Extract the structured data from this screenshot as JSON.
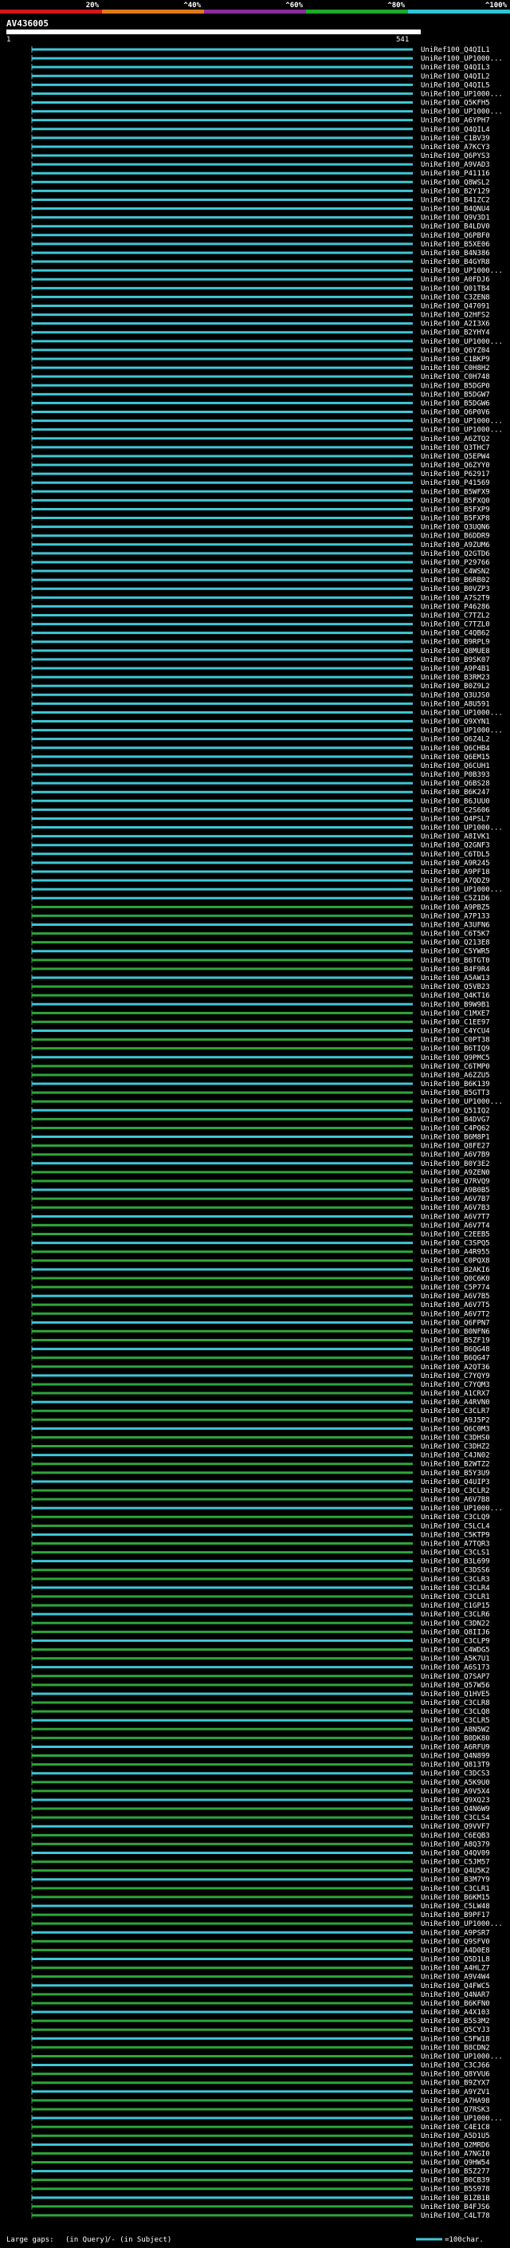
{
  "query_id": "AV436005",
  "colors": {
    "background": "#000000",
    "aligned_low": "#2ea63a",
    "aligned_high": "#3fc7d6",
    "gap": "#000000",
    "text": "#ffffff"
  },
  "legend_top": {
    "segments": [
      {
        "label": "20%",
        "color": "#d4161c"
      },
      {
        "label": "^40%",
        "color": "#e07a18"
      },
      {
        "label": "^60%",
        "color": "#8a2b9e"
      },
      {
        "label": "^80%",
        "color": "#1fa82b"
      },
      {
        "label": "^100%",
        "color": "#2fc4d6"
      }
    ]
  },
  "bottom_legend": {
    "large_gaps_label": "Large gaps:",
    "query_gap_label": "(in Query)",
    "subject_gap_label": "/- (in Subject)",
    "scale_label": "=100char."
  },
  "chart_data": {
    "type": "alignment",
    "title": "AV436005",
    "axis": {
      "start": "1",
      "end": "541"
    },
    "hits": [
      {
        "label": "UniRef100_Q4QIL1",
        "pct": 97
      },
      {
        "label": "UniRef100_UP1000...",
        "pct": 97
      },
      {
        "label": "UniRef100_Q4QIL3",
        "pct": 97
      },
      {
        "label": "UniRef100_Q4QIL2",
        "pct": 97
      },
      {
        "label": "UniRef100_Q4QIL5",
        "pct": 97
      },
      {
        "label": "UniRef100_UP1000...",
        "pct": 97
      },
      {
        "label": "UniRef100_Q5KFH5",
        "pct": 96
      },
      {
        "label": "UniRef100_UP1000...",
        "pct": 96
      },
      {
        "label": "UniRef100_A6YPH7",
        "pct": 96
      },
      {
        "label": "UniRef100_Q4QIL4",
        "pct": 96
      },
      {
        "label": "UniRef100_C1BV39",
        "pct": 96
      },
      {
        "label": "UniRef100_A7KCY3",
        "pct": 96
      },
      {
        "label": "UniRef100_Q6PYS3",
        "pct": 96
      },
      {
        "label": "UniRef100_A9VAD3",
        "pct": 96
      },
      {
        "label": "UniRef100_P41116",
        "pct": 96
      },
      {
        "label": "UniRef100_Q8WSL2",
        "pct": 96
      },
      {
        "label": "UniRef100_B2Y129",
        "pct": 96
      },
      {
        "label": "UniRef100_B41ZC2",
        "pct": 96
      },
      {
        "label": "UniRef100_B4QNU4",
        "pct": 96
      },
      {
        "label": "UniRef100_Q9V3D1",
        "pct": 96
      },
      {
        "label": "UniRef100_B4LDV0",
        "pct": 96
      },
      {
        "label": "UniRef100_Q6PBF0",
        "pct": 96
      },
      {
        "label": "UniRef100_B5XE06",
        "pct": 96
      },
      {
        "label": "UniRef100_B4N386",
        "pct": 96
      },
      {
        "label": "UniRef100_B4GYR8",
        "pct": 96
      },
      {
        "label": "UniRef100_UP1000...",
        "pct": 96
      },
      {
        "label": "UniRef100_A0FDJ6",
        "pct": 96
      },
      {
        "label": "UniRef100_Q01TB4",
        "pct": 96
      },
      {
        "label": "UniRef100_C3ZEN8",
        "pct": 96
      },
      {
        "label": "UniRef100_Q47091",
        "pct": 96
      },
      {
        "label": "UniRef100_Q2HFS2",
        "pct": 96
      },
      {
        "label": "UniRef100_A2I3X6",
        "pct": 96
      },
      {
        "label": "UniRef100_B2YHY4",
        "pct": 96
      },
      {
        "label": "UniRef100_UP1000...",
        "pct": 96
      },
      {
        "label": "UniRef100_Q6YZ04",
        "pct": 96
      },
      {
        "label": "UniRef100_C1BKP9",
        "pct": 96
      },
      {
        "label": "UniRef100_C0H8H2",
        "pct": 96
      },
      {
        "label": "UniRef100_C0H748",
        "pct": 96
      },
      {
        "label": "UniRef100_B5DGP0",
        "pct": 96
      },
      {
        "label": "UniRef100_B5DGW7",
        "pct": 96
      },
      {
        "label": "UniRef100_B5DGW6",
        "pct": 96
      },
      {
        "label": "UniRef100_Q6P0V6",
        "pct": 96
      },
      {
        "label": "UniRef100_UP1000...",
        "pct": 96
      },
      {
        "label": "UniRef100_UP1000...",
        "pct": 96
      },
      {
        "label": "UniRef100_A6ZTQ2",
        "pct": 96
      },
      {
        "label": "UniRef100_Q3THC7",
        "pct": 96
      },
      {
        "label": "UniRef100_Q5EPW4",
        "pct": 96
      },
      {
        "label": "UniRef100_Q6ZYY0",
        "pct": 96
      },
      {
        "label": "UniRef100_P62917",
        "pct": 96
      },
      {
        "label": "UniRef100_P41569",
        "pct": 96
      },
      {
        "label": "UniRef100_B5WFX9",
        "pct": 96
      },
      {
        "label": "UniRef100_B5FXQ0",
        "pct": 96
      },
      {
        "label": "UniRef100_B5FXP9",
        "pct": 96
      },
      {
        "label": "UniRef100_B5FXP8",
        "pct": 96
      },
      {
        "label": "UniRef100_Q3UQN6",
        "pct": 96
      },
      {
        "label": "UniRef100_B6DDR9",
        "pct": 96
      },
      {
        "label": "UniRef100_A9ZUM6",
        "pct": 96
      },
      {
        "label": "UniRef100_Q2GTD6",
        "pct": 96
      },
      {
        "label": "UniRef100_P29766",
        "pct": 96
      },
      {
        "label": "UniRef100_C4WSN2",
        "pct": 96
      },
      {
        "label": "UniRef100_B6RB02",
        "pct": 96
      },
      {
        "label": "UniRef100_B0VZP3",
        "pct": 96
      },
      {
        "label": "UniRef100_A7S2T9",
        "pct": 96
      },
      {
        "label": "UniRef100_P46286",
        "pct": 96
      },
      {
        "label": "UniRef100_C7TZL2",
        "pct": 96
      },
      {
        "label": "UniRef100_C7TZL0",
        "pct": 96
      },
      {
        "label": "UniRef100_C4QB62",
        "pct": 96
      },
      {
        "label": "UniRef100_B9RPL9",
        "pct": 96
      },
      {
        "label": "UniRef100_Q8MUE8",
        "pct": 96
      },
      {
        "label": "UniRef100_B9SK07",
        "pct": 96
      },
      {
        "label": "UniRef100_A9P4B1",
        "pct": 96
      },
      {
        "label": "UniRef100_B3RM23",
        "pct": 96
      },
      {
        "label": "UniRef100_B0Z9L2",
        "pct": 96
      },
      {
        "label": "UniRef100_Q3UJS0",
        "pct": 96
      },
      {
        "label": "UniRef100_A8U591",
        "pct": 96
      },
      {
        "label": "UniRef100_UP1000...",
        "pct": 96
      },
      {
        "label": "UniRef100_Q9XYN1",
        "pct": 96
      },
      {
        "label": "UniRef100_UP1000...",
        "pct": 96
      },
      {
        "label": "UniRef100_Q6Z4L2",
        "pct": 96
      },
      {
        "label": "UniRef100_Q6CHB4",
        "pct": 96
      },
      {
        "label": "UniRef100_Q6EM15",
        "pct": 96
      },
      {
        "label": "UniRef100_Q6CUH1",
        "pct": 96
      },
      {
        "label": "UniRef100_P0B393",
        "pct": 96
      },
      {
        "label": "UniRef100_Q6BS28",
        "pct": 96
      },
      {
        "label": "UniRef100_B6K247",
        "pct": 96
      },
      {
        "label": "UniRef100_B6JUU0",
        "pct": 96
      },
      {
        "label": "UniRef100_C2S606",
        "pct": 96
      },
      {
        "label": "UniRef100_Q4PSL7",
        "pct": 96
      },
      {
        "label": "UniRef100_UP1000...",
        "pct": 96
      },
      {
        "label": "UniRef100_A8IVK1",
        "pct": 96
      },
      {
        "label": "UniRef100_Q2GNF3",
        "pct": 96
      },
      {
        "label": "UniRef100_C6TDL5",
        "pct": 96
      },
      {
        "label": "UniRef100_A9R245",
        "pct": 96
      },
      {
        "label": "UniRef100_A9PF18",
        "pct": 96
      },
      {
        "label": "UniRef100_A7QDZ9",
        "pct": 96
      },
      {
        "label": "UniRef100_UP1000...",
        "pct": 96
      },
      {
        "label": "UniRef100_C5Z1D6",
        "pct": 96
      },
      {
        "label": "UniRef100_A9PBZ5",
        "pct": 96
      },
      {
        "label": "UniRef100_A7P133",
        "pct": 96
      },
      {
        "label": "UniRef100_A3UFN6",
        "pct": 96
      },
      {
        "label": "UniRef100_C6T5K7",
        "pct": 96
      },
      {
        "label": "UniRef100_Q213E8",
        "pct": 96
      },
      {
        "label": "UniRef100_C5YWR5",
        "pct": 96
      },
      {
        "label": "UniRef100_B6TGT0",
        "pct": 96
      },
      {
        "label": "UniRef100_B4F9R4",
        "pct": 96
      },
      {
        "label": "UniRef100_A5AW13",
        "pct": 96
      },
      {
        "label": "UniRef100_Q5VB23",
        "pct": 96
      },
      {
        "label": "UniRef100_Q4KT16",
        "pct": 96
      },
      {
        "label": "UniRef100_B9W9B1",
        "pct": 96
      },
      {
        "label": "UniRef100_C1MXE7",
        "pct": 96
      },
      {
        "label": "UniRef100_C1EE97",
        "pct": 96
      },
      {
        "label": "UniRef100_C4YCU4",
        "pct": 96
      },
      {
        "label": "UniRef100_C0PT38",
        "pct": 96
      },
      {
        "label": "UniRef100_B6TIQ9",
        "pct": 96
      },
      {
        "label": "UniRef100_Q9PMC5",
        "pct": 96
      },
      {
        "label": "UniRef100_C6TMP0",
        "pct": 96
      },
      {
        "label": "UniRef100_A6ZZU5",
        "pct": 96
      },
      {
        "label": "UniRef100_B6K139",
        "pct": 96
      },
      {
        "label": "UniRef100_B5GTT3",
        "pct": 96
      },
      {
        "label": "UniRef100_UP1000...",
        "pct": 96
      },
      {
        "label": "UniRef100_Q51IQ2",
        "pct": 96
      },
      {
        "label": "UniRef100_B4DVG7",
        "pct": 96
      },
      {
        "label": "UniRef100_C4PQ62",
        "pct": 96
      },
      {
        "label": "UniRef100_B6M8P1",
        "pct": 96
      },
      {
        "label": "UniRef100_Q8FE27",
        "pct": 96
      },
      {
        "label": "UniRef100_A6V7B9",
        "pct": 96
      },
      {
        "label": "UniRef100_B0Y3E2",
        "pct": 96
      },
      {
        "label": "UniRef100_A9ZEN0",
        "pct": 96
      },
      {
        "label": "UniRef100_Q7RVQ9",
        "pct": 96
      },
      {
        "label": "UniRef100_A9B0B5",
        "pct": 96
      },
      {
        "label": "UniRef100_A6V7B7",
        "pct": 96
      },
      {
        "label": "UniRef100_A6V7B3",
        "pct": 96
      },
      {
        "label": "UniRef100_A6V7T7",
        "pct": 96
      },
      {
        "label": "UniRef100_A6V7T4",
        "pct": 96
      },
      {
        "label": "UniRef100_C2EEB5",
        "pct": 96
      },
      {
        "label": "UniRef100_C3SPQ5",
        "pct": 96
      },
      {
        "label": "UniRef100_A4R955",
        "pct": 96
      },
      {
        "label": "UniRef100_C0PQX8",
        "pct": 96
      },
      {
        "label": "UniRef100_B2AKI6",
        "pct": 96
      },
      {
        "label": "UniRef100_Q0C6K0",
        "pct": 96
      },
      {
        "label": "UniRef100_C5P774",
        "pct": 96
      },
      {
        "label": "UniRef100_A6V7B5",
        "pct": 96
      },
      {
        "label": "UniRef100_A6V7T5",
        "pct": 96
      },
      {
        "label": "UniRef100_A6V7T2",
        "pct": 96
      },
      {
        "label": "UniRef100_Q6FPN7",
        "pct": 96
      },
      {
        "label": "UniRef100_B0NFN6",
        "pct": 96
      },
      {
        "label": "UniRef100_B5ZF19",
        "pct": 96
      },
      {
        "label": "UniRef100_B6QG48",
        "pct": 96
      },
      {
        "label": "UniRef100_B6QG47",
        "pct": 96
      },
      {
        "label": "UniRef100_A2QT36",
        "pct": 96
      },
      {
        "label": "UniRef100_C7YQY9",
        "pct": 96
      },
      {
        "label": "UniRef100_C7YQM3",
        "pct": 96
      },
      {
        "label": "UniRef100_A1CRX7",
        "pct": 96
      },
      {
        "label": "UniRef100_A4RVN0",
        "pct": 96
      },
      {
        "label": "UniRef100_C3CLR7",
        "pct": 96
      },
      {
        "label": "UniRef100_A9J5P2",
        "pct": 96
      },
      {
        "label": "UniRef100_Q6C0M3",
        "pct": 96
      },
      {
        "label": "UniRef100_C3DHS0",
        "pct": 96
      },
      {
        "label": "UniRef100_C3DHZ2",
        "pct": 96
      },
      {
        "label": "UniRef100_C4JN02",
        "pct": 96
      },
      {
        "label": "UniRef100_B2WTZ2",
        "pct": 96
      },
      {
        "label": "UniRef100_B5Y3U9",
        "pct": 96
      },
      {
        "label": "UniRef100_Q4UIP3",
        "pct": 96
      },
      {
        "label": "UniRef100_C3CLR2",
        "pct": 96
      },
      {
        "label": "UniRef100_A6V7B8",
        "pct": 96
      },
      {
        "label": "UniRef100_UP1000...",
        "pct": 96
      },
      {
        "label": "UniRef100_C3CLQ9",
        "pct": 96
      },
      {
        "label": "UniRef100_C5LCL4",
        "pct": 96
      },
      {
        "label": "UniRef100_C5KTP9",
        "pct": 96
      },
      {
        "label": "UniRef100_A7TQR3",
        "pct": 96
      },
      {
        "label": "UniRef100_C3CLS1",
        "pct": 96
      },
      {
        "label": "UniRef100_B3L699",
        "pct": 96
      },
      {
        "label": "UniRef100_C3DSS6",
        "pct": 96
      },
      {
        "label": "UniRef100_C3CLR3",
        "pct": 96
      },
      {
        "label": "UniRef100_C3CLR4",
        "pct": 96
      },
      {
        "label": "UniRef100_C3CLR1",
        "pct": 96
      },
      {
        "label": "UniRef100_C1GP15",
        "pct": 96
      },
      {
        "label": "UniRef100_C3CLR6",
        "pct": 96
      },
      {
        "label": "UniRef100_C3DN22",
        "pct": 96
      },
      {
        "label": "UniRef100_Q8IIJ6",
        "pct": 96
      },
      {
        "label": "UniRef100_C3CLP9",
        "pct": 96
      },
      {
        "label": "UniRef100_C4WDG5",
        "pct": 96
      },
      {
        "label": "UniRef100_A5K7U1",
        "pct": 96
      },
      {
        "label": "UniRef100_A6S173",
        "pct": 96
      },
      {
        "label": "UniRef100_Q7SAP7",
        "pct": 96
      },
      {
        "label": "UniRef100_Q57W56",
        "pct": 96
      },
      {
        "label": "UniRef100_Q1HVE5",
        "pct": 96
      },
      {
        "label": "UniRef100_C3CLR8",
        "pct": 96
      },
      {
        "label": "UniRef100_C3CLQ8",
        "pct": 96
      },
      {
        "label": "UniRef100_C3CLR5",
        "pct": 96
      },
      {
        "label": "UniRef100_A8N5W2",
        "pct": 96
      },
      {
        "label": "UniRef100_B0DK80",
        "pct": 96
      },
      {
        "label": "UniRef100_A6RFU9",
        "pct": 96
      },
      {
        "label": "UniRef100_Q4N899",
        "pct": 96
      },
      {
        "label": "UniRef100_Q813T9",
        "pct": 96
      },
      {
        "label": "UniRef100_C3DCS3",
        "pct": 96
      },
      {
        "label": "UniRef100_A5K9U0",
        "pct": 96
      },
      {
        "label": "UniRef100_A9V5X4",
        "pct": 96
      },
      {
        "label": "UniRef100_Q9XQ23",
        "pct": 96
      },
      {
        "label": "UniRef100_Q4N6W9",
        "pct": 96
      },
      {
        "label": "UniRef100_C3CLS4",
        "pct": 96
      },
      {
        "label": "UniRef100_Q9VVF7",
        "pct": 96
      },
      {
        "label": "UniRef100_C6EQB3",
        "pct": 96
      },
      {
        "label": "UniRef100_A8Q379",
        "pct": 96
      },
      {
        "label": "UniRef100_Q4QV09",
        "pct": 96
      },
      {
        "label": "UniRef100_C5JM57",
        "pct": 96
      },
      {
        "label": "UniRef100_Q4U5K2",
        "pct": 96
      },
      {
        "label": "UniRef100_B3M7Y9",
        "pct": 96
      },
      {
        "label": "UniRef100_C3CLR1",
        "pct": 96
      },
      {
        "label": "UniRef100_B6KM15",
        "pct": 96
      },
      {
        "label": "UniRef100_C5LW48",
        "pct": 96
      },
      {
        "label": "UniRef100_B9PF17",
        "pct": 96
      },
      {
        "label": "UniRef100_UP1000...",
        "pct": 96
      },
      {
        "label": "UniRef100_A9PSR7",
        "pct": 96
      },
      {
        "label": "UniRef100_Q9SFV0",
        "pct": 96
      },
      {
        "label": "UniRef100_A4D0E8",
        "pct": 96
      },
      {
        "label": "UniRef100_Q5D1L8",
        "pct": 96
      },
      {
        "label": "UniRef100_A4HLZ7",
        "pct": 96
      },
      {
        "label": "UniRef100_A9V4W4",
        "pct": 96
      },
      {
        "label": "UniRef100_Q4FWC5",
        "pct": 96
      },
      {
        "label": "UniRef100_Q4NAR7",
        "pct": 96
      },
      {
        "label": "UniRef100_B6KFN0",
        "pct": 96
      },
      {
        "label": "UniRef100_A4X103",
        "pct": 96
      },
      {
        "label": "UniRef100_B5S3M2",
        "pct": 96
      },
      {
        "label": "UniRef100_Q5CYJ3",
        "pct": 96
      },
      {
        "label": "UniRef100_C5FW18",
        "pct": 96
      },
      {
        "label": "UniRef100_B8CDN2",
        "pct": 96
      },
      {
        "label": "UniRef100_UP1000...",
        "pct": 96
      },
      {
        "label": "UniRef100_C3CJ66",
        "pct": 96
      },
      {
        "label": "UniRef100_Q8YVU6",
        "pct": 96
      },
      {
        "label": "UniRef100_B9ZYX7",
        "pct": 96
      },
      {
        "label": "UniRef100_A9YZV1",
        "pct": 96
      },
      {
        "label": "UniRef100_A7HA98",
        "pct": 96
      },
      {
        "label": "UniRef100_Q7RSK3",
        "pct": 96
      },
      {
        "label": "UniRef100_UP1000...",
        "pct": 96
      },
      {
        "label": "UniRef100_C4E1C8",
        "pct": 96
      },
      {
        "label": "UniRef100_A5D1U5",
        "pct": 96
      },
      {
        "label": "UniRef100_Q2MRD6",
        "pct": 96
      },
      {
        "label": "UniRef100_A7NGI0",
        "pct": 96
      },
      {
        "label": "UniRef100_Q9HW54",
        "pct": 96
      },
      {
        "label": "UniRef100_B5Z277",
        "pct": 96
      },
      {
        "label": "UniRef100_B0CB39",
        "pct": 96
      },
      {
        "label": "UniRef100_B5S978",
        "pct": 96
      },
      {
        "label": "UniRef100_B1ZB1B",
        "pct": 96
      },
      {
        "label": "UniRef100_B4FJS6",
        "pct": 96
      },
      {
        "label": "UniRef100_C4LT78",
        "pct": 96
      }
    ]
  }
}
